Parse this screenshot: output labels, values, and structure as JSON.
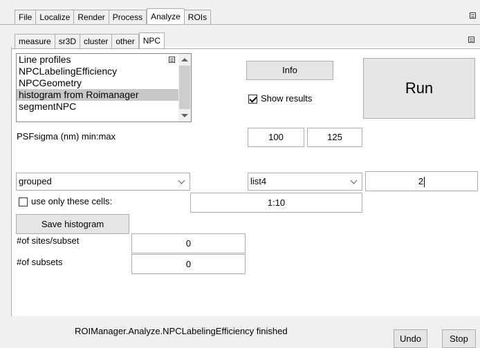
{
  "main_tabs": [
    "File",
    "Localize",
    "Render",
    "Process",
    "Analyze",
    "ROIs"
  ],
  "main_active": "Analyze",
  "sub_tabs": [
    "measure",
    "sr3D",
    "cluster",
    "other",
    "NPC"
  ],
  "sub_active": "NPC",
  "plugin_list": {
    "items": [
      "Line profiles",
      "NPCLabelingEfficiency",
      "NPCGeometry",
      "histogram from Roimanager",
      "segmentNPC"
    ],
    "selected": "histogram from Roimanager"
  },
  "info_button": "Info",
  "run_button": "Run",
  "show_results": {
    "label": "Show results",
    "checked": true
  },
  "psf": {
    "label": "PSFsigma (nm) min:max",
    "min": "100",
    "max": "125"
  },
  "grouping_select": "grouped",
  "list_select": "list4",
  "list_value": "2",
  "only_cells": {
    "label": "use only these cells:",
    "checked": false,
    "value": "1:10"
  },
  "save_histogram_button": "Save histogram",
  "sites_per_subset": {
    "label": "#of sites/subset",
    "value": "0"
  },
  "num_subsets": {
    "label": "#of subsets",
    "value": "0"
  },
  "status": "ROIManager.Analyze.NPCLabelingEfficiency finished",
  "undo_button": "Undo",
  "stop_button": "Stop"
}
